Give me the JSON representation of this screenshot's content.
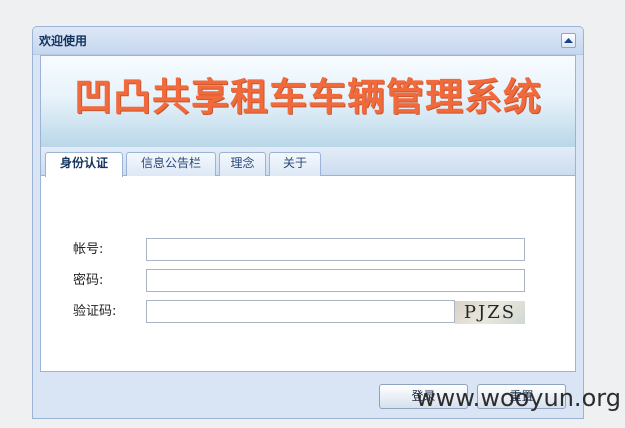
{
  "panel": {
    "title": "欢迎使用"
  },
  "banner": {
    "title": "凹凸共享租车车辆管理系统",
    "color": "#f06a3c"
  },
  "tabs": [
    {
      "label": "身份认证",
      "active": true
    },
    {
      "label": "信息公告栏",
      "active": false
    },
    {
      "label": "理念",
      "active": false
    },
    {
      "label": "关于",
      "active": false
    }
  ],
  "form": {
    "account_label": "帐号:",
    "account_value": "",
    "password_label": "密码:",
    "password_value": "",
    "captcha_label": "验证码:",
    "captcha_value": "",
    "captcha_image_text": "PJZS"
  },
  "buttons": {
    "login_label": "登录",
    "reset_label": "重置"
  },
  "watermark": "www.wooyun.org",
  "icons": {
    "collapse": "chevron-up-icon"
  }
}
